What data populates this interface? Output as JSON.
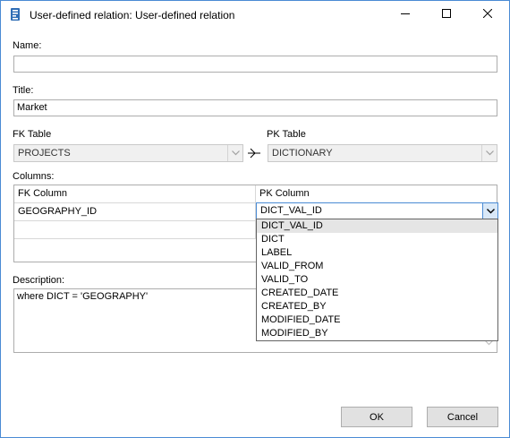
{
  "window": {
    "title": "User-defined relation: User-defined relation",
    "icons": {
      "app": "relation-app-icon",
      "minimize": "minimize-icon",
      "maximize": "maximize-icon",
      "close": "close-icon"
    }
  },
  "form": {
    "name_label": "Name:",
    "name_value": "",
    "title_label": "Title:",
    "title_value": "Market",
    "fk_table_label": "FK Table",
    "fk_table_value": "PROJECTS",
    "pk_table_label": "PK Table",
    "pk_table_value": "DICTIONARY",
    "relation_icon": "relation-arrow-icon",
    "columns_label": "Columns:",
    "columns_grid": {
      "headers": [
        "FK Column",
        "PK Column"
      ],
      "rows": [
        {
          "fk": "GEOGRAPHY_ID",
          "pk": "DICT_VAL_ID"
        },
        {
          "fk": "",
          "pk": ""
        }
      ]
    },
    "pk_dropdown": {
      "selected": "DICT_VAL_ID",
      "options": [
        "DICT_VAL_ID",
        "DICT",
        "LABEL",
        "VALID_FROM",
        "VALID_TO",
        "CREATED_DATE",
        "CREATED_BY",
        "MODIFIED_DATE",
        "MODIFIED_BY"
      ]
    },
    "description_label": "Description:",
    "description_value": "where DICT = 'GEOGRAPHY'"
  },
  "buttons": {
    "ok": "OK",
    "cancel": "Cancel"
  },
  "colors": {
    "accent": "#4a8bd4",
    "selection": "#e5e5e5",
    "button_bg": "#e1e1e1"
  }
}
